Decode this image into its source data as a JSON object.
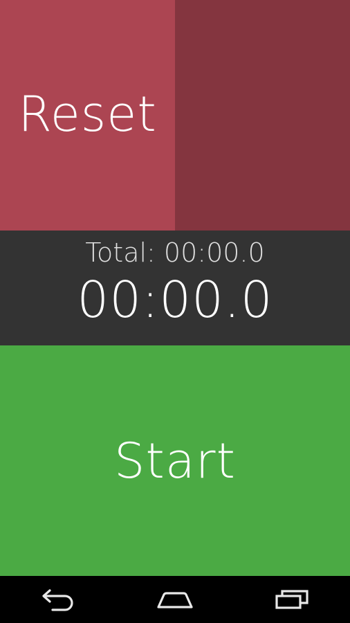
{
  "colors": {
    "reset_bg": "#AC4552",
    "blank_bg": "#84353F",
    "timer_bg": "#333333",
    "start_bg": "#4BAA44",
    "nav_bg": "#000000",
    "nav_icon": "#E8E8E8"
  },
  "buttons": {
    "reset_label": "Reset",
    "start_label": "Start"
  },
  "timer": {
    "total_text": "Total: 00:00.0",
    "current_text": "00:00.0"
  },
  "nav": {
    "back_icon": "back-icon",
    "home_icon": "home-icon",
    "recents_icon": "recents-icon"
  }
}
